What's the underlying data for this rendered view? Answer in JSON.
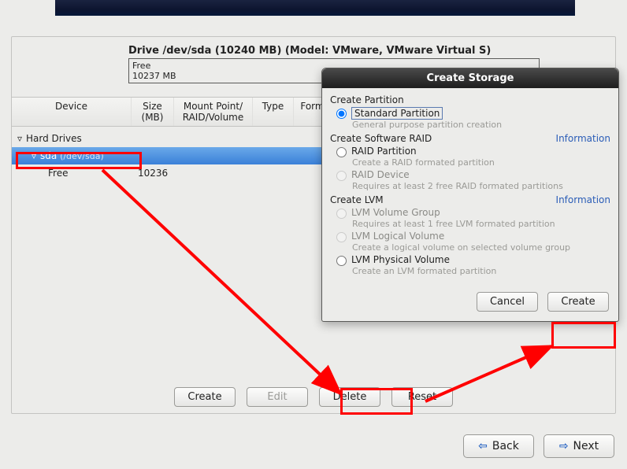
{
  "drive": {
    "title": "Drive /dev/sda (10240 MB) (Model: VMware, VMware Virtual S)",
    "block_line1": "Free",
    "block_line2": "10237 MB"
  },
  "columns": {
    "device": "Device",
    "size": "Size\n(MB)",
    "mount": "Mount Point/\nRAID/Volume",
    "type": "Type",
    "format": "Format"
  },
  "tree": {
    "hard_drives": "Hard Drives",
    "sda": "sda",
    "sda_path": "(/dev/sda)",
    "free": "Free",
    "free_size": "10236"
  },
  "buttons": {
    "create": "Create",
    "edit": "Edit",
    "delete": "Delete",
    "reset": "Reset",
    "back": "Back",
    "next": "Next"
  },
  "dialog": {
    "title": "Create Storage",
    "sect_partition": "Create Partition",
    "opt_std": "Standard Partition",
    "hint_std": "General purpose partition creation",
    "sect_raid": "Create Software RAID",
    "info": "Information",
    "opt_raid_part": "RAID Partition",
    "hint_raid_part": "Create a RAID formated partition",
    "opt_raid_dev": "RAID Device",
    "hint_raid_dev": "Requires at least 2 free RAID formated partitions",
    "sect_lvm": "Create LVM",
    "opt_lvm_vg": "LVM Volume Group",
    "hint_lvm_vg": "Requires at least 1 free LVM formated partition",
    "opt_lvm_lv": "LVM Logical Volume",
    "hint_lvm_lv": "Create a logical volume on selected volume group",
    "opt_lvm_pv": "LVM Physical Volume",
    "hint_lvm_pv": "Create an LVM formated partition",
    "cancel": "Cancel",
    "create": "Create"
  }
}
